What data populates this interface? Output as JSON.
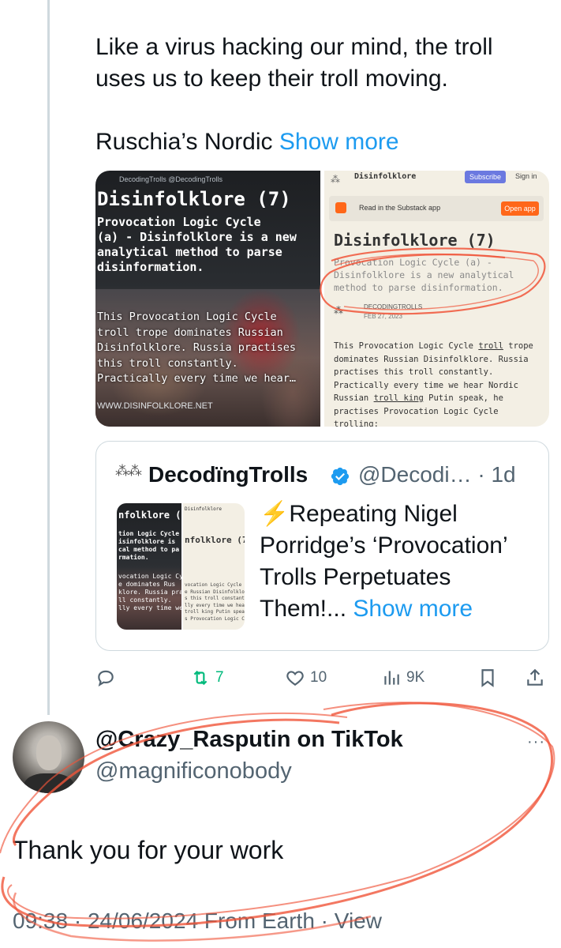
{
  "tweet": {
    "text_line1": "Like a virus hacking our mind, the troll",
    "text_line2": "uses us to keep their troll moving.",
    "text_truncated": "Ruschia’s Nordic ",
    "show_more": "Show more"
  },
  "media_left": {
    "brand": "DecodingTrolls @DecodingTrolls",
    "title": "Disinfolklore (7)",
    "subtitle": "Provocation Logic Cycle\n(a) - Disinfolklore is a new\nanalytical method to parse\ndisinformation.",
    "body": "This Provocation Logic Cycle\ntroll trope dominates Russian\nDisinfolklore. Russia practises\nthis troll constantly.\nPractically every time we hear…",
    "url": "WWW.DISINFOLKLORE.NET"
  },
  "media_right": {
    "brand": "Disinfolklore",
    "subscribe": "Subscribe",
    "sign_in": "Sign in",
    "app_banner": "Read in the Substack app",
    "open_app": "Open app",
    "title": "Disinfolklore (7)",
    "description": "Provocation Logic Cycle (a) -\nDisinfolklore is a new analytical\nmethod to parse disinformation.",
    "author": "DECODINGTROLLS",
    "date": "FEB 27, 2023",
    "body_line1": "This Provocation Logic Cycle ",
    "body_link1": "troll",
    "body_line1b": " trope",
    "body_rest1": "dominates Russian Disinfolklore. Russia\npractises this troll constantly.\nPractically every time we hear Nordic\nRussian ",
    "body_link2": "troll king",
    "body_rest2": " Putin speak, he\npractises Provocation Logic Cycle\ntrolling:"
  },
  "quote": {
    "name": "DecodïngTrolls",
    "handle": "@Decodi… · 1d",
    "thumb_left_title": "nfolklore (\n",
    "thumb_left_body": "tion Logic Cycle\nisinfolklore is\ncal method to pa\nrmation.",
    "thumb_left_lower": "vocation Logic Cy\ne dominates Rus\nklore. Russia pra\nll constantly.\nlly every time we",
    "thumb_right_top": "Disinfolklore",
    "thumb_right_title": "nfolklore (7)",
    "thumb_right_body": "vocation Logic Cycle trol\ne Russian Disinfolklore.\ns this troll constantly.\nlly every time we hear No\ntroll king Putin speak, h\ns Provocation Logic Cycle",
    "text": "⚡️Repeating Nigel Porridge’s ‘Provocation’ Trolls Perpetuates Them!... ",
    "show_more": "Show more"
  },
  "actions": {
    "replies": "",
    "retweets": "7",
    "likes": "10",
    "views": "9K"
  },
  "reply": {
    "name": "@Crazy_Rasputin on TikTok",
    "handle": "@magnificonobody",
    "more": "···",
    "text": "Thank you for your work",
    "meta": "09:38 · 24/06/2024 From Earth · View"
  },
  "colors": {
    "accent": "#1d9bf0",
    "retweet": "#00ba7c",
    "secondary_text": "#536471",
    "annotation": "#f0553a"
  }
}
